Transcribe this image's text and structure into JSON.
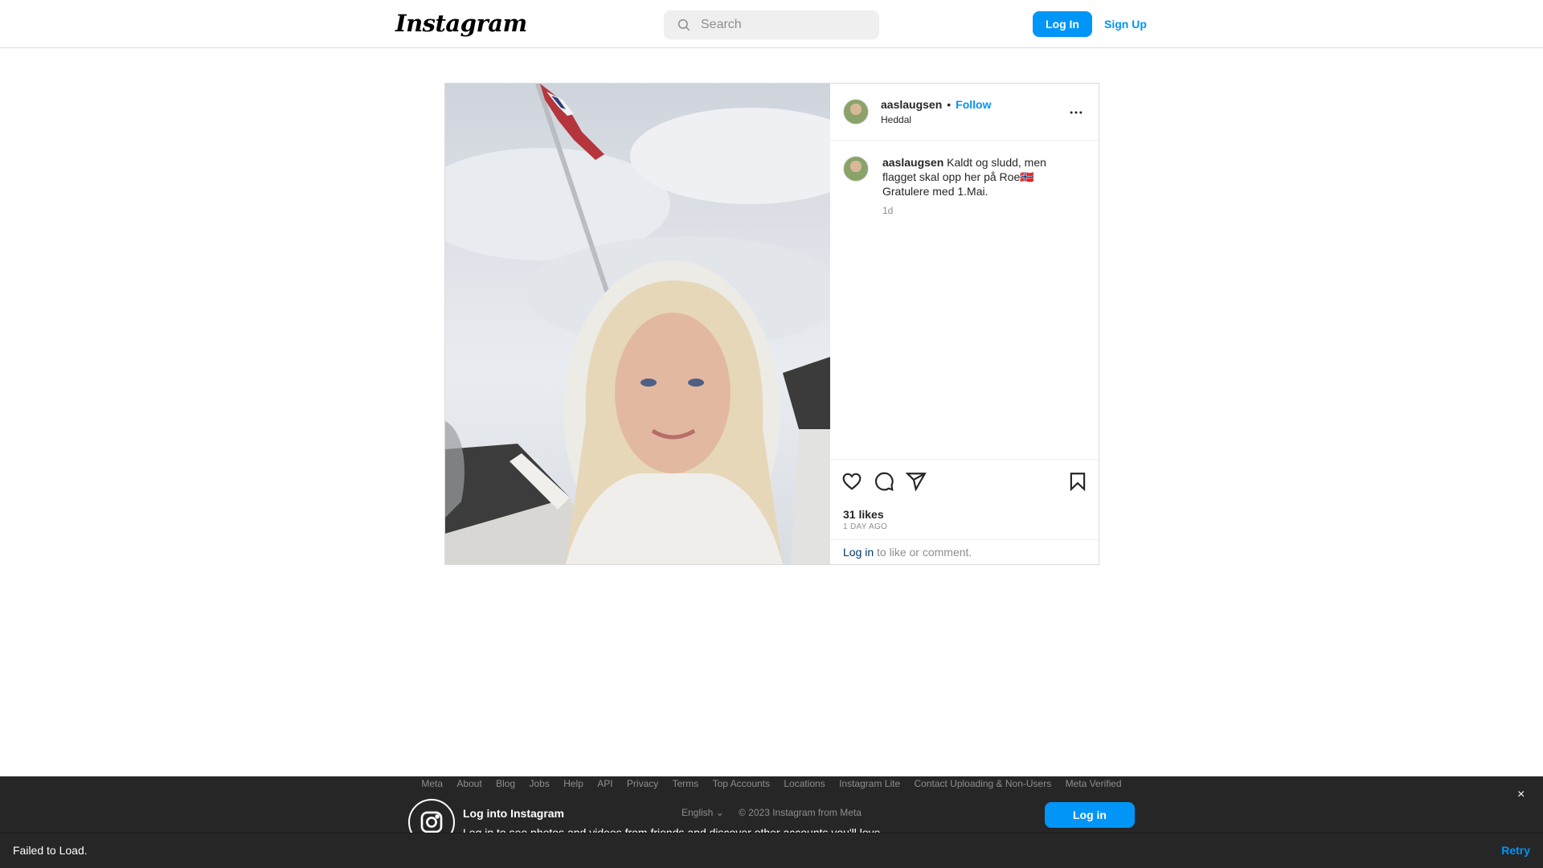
{
  "header": {
    "logo": "Instagram",
    "search_placeholder": "Search",
    "login_label": "Log In",
    "signup_label": "Sign Up"
  },
  "post": {
    "username": "aaslaugsen",
    "separator": "•",
    "follow_label": "Follow",
    "location": "Heddal",
    "caption_username": "aaslaugsen",
    "caption_text": "Kaldt og sludd, men flagget skal opp her på Roe🇳🇴 Gratulere med 1.Mai.",
    "caption_time": "1d",
    "likes": "31 likes",
    "time_ago": "1 DAY AGO",
    "comment_login_link": "Log in",
    "comment_prompt": " to like or comment."
  },
  "footer": {
    "links": [
      "Meta",
      "About",
      "Blog",
      "Jobs",
      "Help",
      "API",
      "Privacy",
      "Terms",
      "Top Accounts",
      "Locations",
      "Instagram Lite",
      "Contact Uploading & Non-Users",
      "Meta Verified"
    ],
    "language": "English",
    "copyright": "© 2023 Instagram from Meta"
  },
  "banner": {
    "title": "Log into Instagram",
    "subtitle": "Log in to see photos and videos from friends and discover other accounts you'll love.",
    "login_label": "Log in",
    "close": "×"
  },
  "status": {
    "message": "Failed to Load.",
    "retry_label": "Retry"
  }
}
